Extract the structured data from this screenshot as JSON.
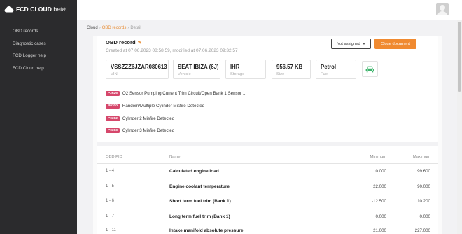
{
  "brand": {
    "name": "FCD CLOUD",
    "suffix": "beta",
    "collapse": "«"
  },
  "nav": [
    "OBD records",
    "Diagnostic cases",
    "FCD Logger help",
    "FCD Cloud help"
  ],
  "breadcrumb": {
    "root": "Cloud",
    "section": "OBD records",
    "current": "Detail",
    "sep": "›"
  },
  "record": {
    "title": "OBD record",
    "meta": "Created at 07.06.2023 08:58:59, modified at 07.06.2023 09:32:57",
    "assign_label": "Not assigned",
    "close_label": "Close document",
    "more": "···"
  },
  "info": [
    {
      "value": "VSSZZZ6JZAR080613",
      "label": "VIN"
    },
    {
      "value": "SEAT IBIZA (6J)",
      "label": "Vehicle"
    },
    {
      "value": "IHR",
      "label": "Storage"
    },
    {
      "value": "956.57 KB",
      "label": "Size"
    },
    {
      "value": "Petrol",
      "label": "Fuel"
    }
  ],
  "dtcs": [
    {
      "code": "P2626",
      "text": "O2 Sensor Pumping Current Trim Circuit/Open Bank 1 Sensor 1"
    },
    {
      "code": "P0300",
      "text": "Random/Multiple Cylinder Misfire Detected"
    },
    {
      "code": "P0302",
      "text": "Cylinder 2 Misfire Detected"
    },
    {
      "code": "P0303",
      "text": "Cylinder 3 Misfire Detected"
    }
  ],
  "table": {
    "headers": {
      "pid": "OBD PID",
      "name": "Name",
      "min": "Minimum",
      "max": "Maximum"
    },
    "rows": [
      {
        "pid": "1 - 4",
        "name": "Calculated engine load",
        "min": "0.000",
        "max": "99.600"
      },
      {
        "pid": "1 - 5",
        "name": "Engine coolant temperature",
        "min": "22.000",
        "max": "90.000"
      },
      {
        "pid": "1 - 6",
        "name": "Short term fuel trim (Bank 1)",
        "min": "-12.500",
        "max": "10.200"
      },
      {
        "pid": "1 - 7",
        "name": "Long term fuel trim (Bank 1)",
        "min": "0.000",
        "max": "0.000"
      },
      {
        "pid": "1 - 11",
        "name": "Intake manifold absolute pressure",
        "min": "21.000",
        "max": "227.000"
      }
    ]
  },
  "colors": {
    "accent": "#f08a30",
    "dtc_badge": "#d6476b",
    "fuel_icon": "#3bb36a",
    "sidebar": "#2b2b2d"
  }
}
